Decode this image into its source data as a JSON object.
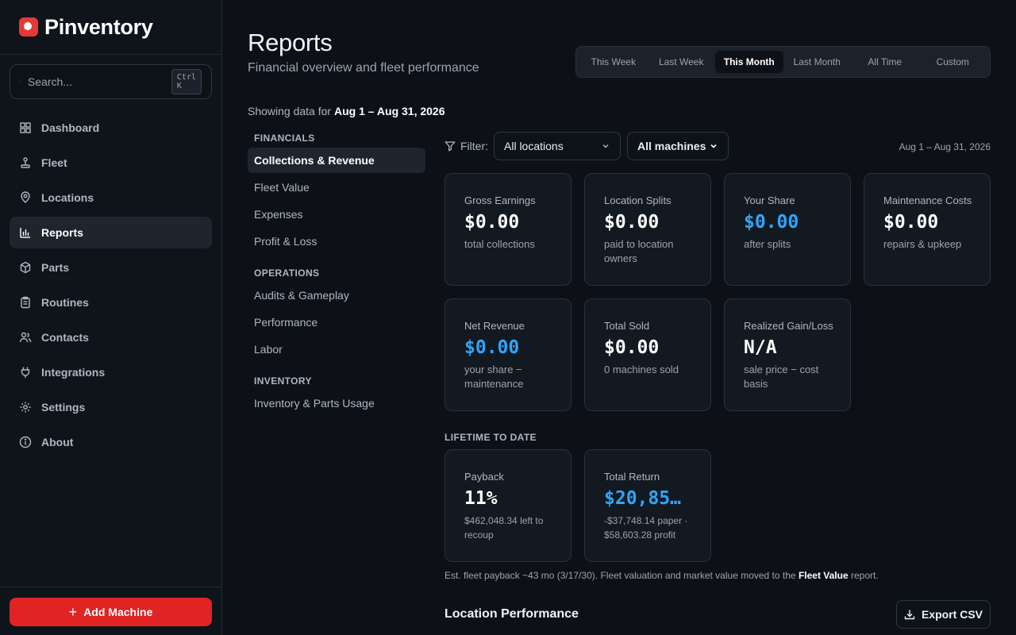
{
  "app": {
    "name": "Pinventory"
  },
  "search": {
    "placeholder": "Search...",
    "shortcut": "Ctrl K"
  },
  "sidebar": {
    "items": [
      {
        "label": "Dashboard"
      },
      {
        "label": "Fleet"
      },
      {
        "label": "Locations"
      },
      {
        "label": "Reports"
      },
      {
        "label": "Parts"
      },
      {
        "label": "Routines"
      },
      {
        "label": "Contacts"
      },
      {
        "label": "Integrations"
      },
      {
        "label": "Settings"
      },
      {
        "label": "About"
      }
    ],
    "add_label": "Add Machine"
  },
  "header": {
    "title": "Reports",
    "subtitle": "Financial overview and fleet performance"
  },
  "range_tabs": [
    "This Week",
    "Last Week",
    "This Month",
    "Last Month",
    "All Time",
    "Custom"
  ],
  "range_tab_active": "This Month",
  "showing": {
    "prefix": "Showing data for",
    "range": "Aug 1 – Aug 31, 2026"
  },
  "report_nav": {
    "sections": [
      {
        "title": "FINANCIALS",
        "items": [
          "Collections & Revenue",
          "Fleet Value",
          "Expenses",
          "Profit & Loss"
        ]
      },
      {
        "title": "OPERATIONS",
        "items": [
          "Audits & Gameplay",
          "Performance",
          "Labor"
        ]
      },
      {
        "title": "INVENTORY",
        "items": [
          "Inventory & Parts Usage"
        ]
      }
    ],
    "active": "Collections & Revenue"
  },
  "filters": {
    "label": "Filter:",
    "location": "All locations",
    "machines": "All machines",
    "date_range": "Aug 1 – Aug 31, 2026"
  },
  "cards": [
    {
      "label": "Gross Earnings",
      "value": "$0.00",
      "sub": "total collections"
    },
    {
      "label": "Location Splits",
      "value": "$0.00",
      "sub": "paid to location owners"
    },
    {
      "label": "Your Share",
      "value": "$0.00",
      "sub": "after splits"
    },
    {
      "label": "Maintenance Costs",
      "value": "$0.00",
      "sub": "repairs & upkeep"
    },
    {
      "label": "Net Revenue",
      "value": "$0.00",
      "sub": "your share − maintenance"
    },
    {
      "label": "Total Sold",
      "value": "$0.00",
      "sub": "0 machines sold"
    },
    {
      "label": "Realized Gain/Loss",
      "value": "N/A",
      "sub": "sale price − cost basis"
    }
  ],
  "lifetime": {
    "title": "LIFETIME TO DATE",
    "cards": [
      {
        "label": "Payback",
        "value": "11%",
        "sub": "$462,048.34 left to recoup"
      },
      {
        "label": "Total Return",
        "value": "$20,85…",
        "sub": "-$37,748.14 paper · $58,603.28 profit"
      }
    ]
  },
  "footnote": {
    "text": "Est. fleet payback ~43 mo (3/17/30). Fleet valuation and market value moved to the",
    "link": "Fleet Value",
    "suffix": "report."
  },
  "location_performance": {
    "title": "Location Performance",
    "export_label": "Export CSV"
  },
  "colors": {
    "accent_red": "#e02424",
    "value_blue": "#2ea6ff",
    "background": "#0d1117"
  }
}
